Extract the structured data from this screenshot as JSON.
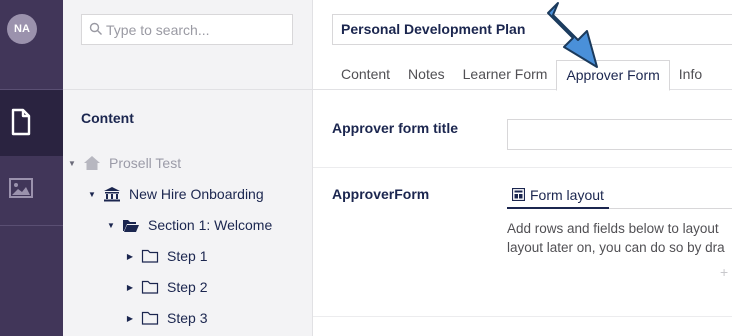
{
  "user": {
    "initials": "NA"
  },
  "rail": {
    "items": [
      {
        "icon": "document-icon",
        "active": true
      },
      {
        "icon": "image-icon",
        "active": false
      }
    ]
  },
  "tree": {
    "search_placeholder": "Type to search...",
    "title": "Content",
    "nodes": [
      {
        "label": "Prosell Test",
        "icon": "home-icon",
        "expanded": true
      },
      {
        "label": "New Hire Onboarding",
        "icon": "institution-icon",
        "expanded": true
      },
      {
        "label": "Section 1: Welcome",
        "icon": "folder-open-icon",
        "expanded": true
      },
      {
        "label": "Step 1",
        "icon": "folder-icon",
        "expanded": false
      },
      {
        "label": "Step 2",
        "icon": "folder-icon",
        "expanded": false
      },
      {
        "label": "Step 3",
        "icon": "folder-icon",
        "expanded": false
      }
    ]
  },
  "editor": {
    "name": "Personal Development Plan",
    "tabs": [
      "Content",
      "Notes",
      "Learner Form",
      "Approver Form",
      "Info"
    ],
    "active_tab": "Approver Form",
    "fields": {
      "approver_form_title_label": "Approver form title",
      "approver_form_title_value": "",
      "approver_form_label": "ApproverForm",
      "form_layout_tab": "Form layout",
      "help_line1": "Add rows and fields below to layout",
      "help_line2": "layout later on, you can do so by dra",
      "add_symbol": "+"
    }
  },
  "colors": {
    "rail": "#413659",
    "rail_active": "#2a2340",
    "text": "#1b264f",
    "arrow": "#4a90d9"
  }
}
